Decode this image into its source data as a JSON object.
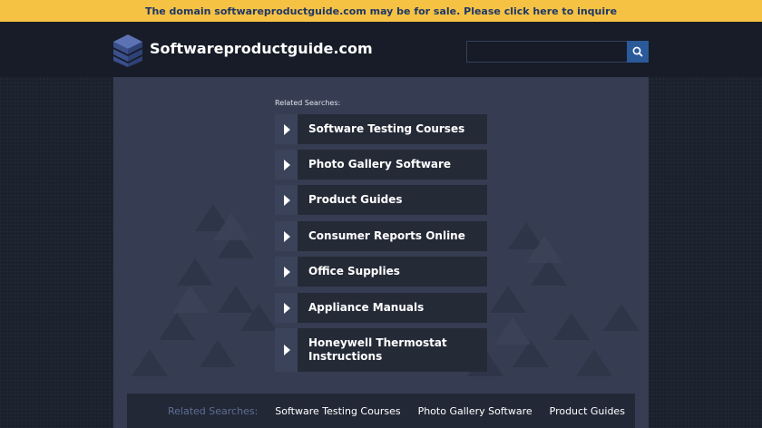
{
  "top_banner": {
    "text": "The domain softwareproductguide.com may be for sale. Please click here to inquire"
  },
  "header": {
    "site_name": "Softwareproductguide.com",
    "search": {
      "value": "",
      "placeholder": ""
    }
  },
  "icons": {
    "logo": "layered-cubes-logo",
    "search": "search-icon",
    "item_arrow": "play-arrow-icon"
  },
  "colors": {
    "banner": "#f6c244",
    "banner_text": "#1e3766",
    "search_button": "#2b5a9a",
    "panel": "#363d52",
    "item_bg": "#252a37"
  },
  "related": {
    "label": "Related Searches:",
    "items": [
      {
        "label": "Software Testing Courses"
      },
      {
        "label": "Photo Gallery Software"
      },
      {
        "label": "Product Guides"
      },
      {
        "label": "Consumer Reports Online"
      },
      {
        "label": "Office Supplies"
      },
      {
        "label": "Appliance Manuals"
      },
      {
        "label": "Honeywell Thermostat Instructions"
      }
    ]
  },
  "footer": {
    "label": "Related Searches:",
    "links": [
      "Software Testing Courses",
      "Photo Gallery Software",
      "Product Guides"
    ]
  }
}
